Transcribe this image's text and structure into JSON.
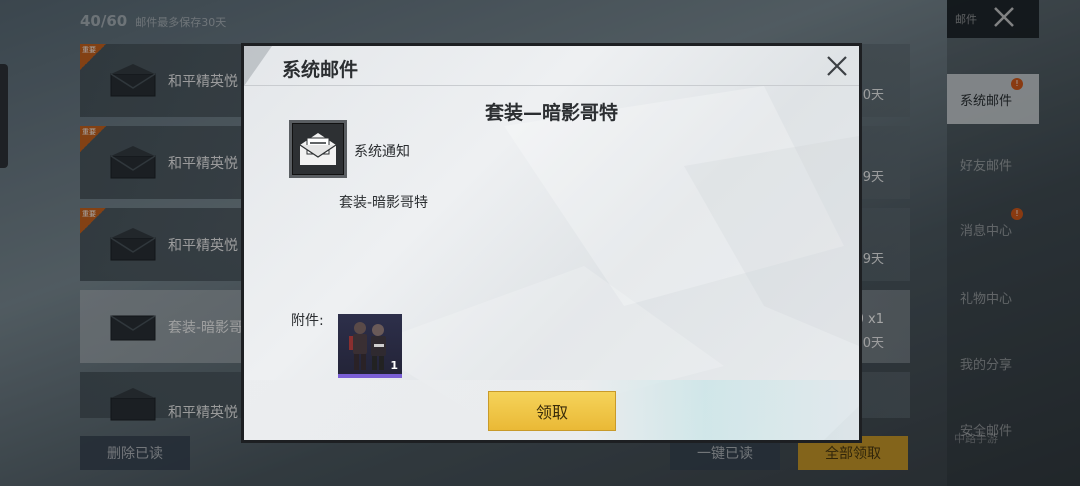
{
  "mailbox": {
    "count": "40/60",
    "note": "邮件最多保存30天",
    "new_badge": "重要",
    "items": [
      {
        "title": "和平精英悦",
        "days": "0天",
        "qty": ""
      },
      {
        "title": "和平精英悦",
        "days": "9天",
        "qty": ""
      },
      {
        "title": "和平精英悦",
        "days": "9天",
        "qty": ""
      },
      {
        "title": "套装-暗影哥",
        "days": "0天",
        "qty": "0 x1"
      },
      {
        "title": "和平精英悦",
        "days": "",
        "qty": ""
      }
    ],
    "delete_read_label": "删除已读",
    "read_all_label": "一键已读",
    "claim_all_label": "全部领取"
  },
  "sidebar": {
    "header_label": "邮件",
    "items": [
      {
        "label": "系统邮件",
        "active": true,
        "dot": "!"
      },
      {
        "label": "好友邮件",
        "active": false,
        "dot": ""
      },
      {
        "label": "消息中心",
        "active": false,
        "dot": "!"
      },
      {
        "label": "礼物中心",
        "active": false,
        "dot": ""
      },
      {
        "label": "我的分享",
        "active": false,
        "dot": ""
      },
      {
        "label": "安全邮件",
        "active": false,
        "dot": ""
      }
    ],
    "watermark": "中路手游"
  },
  "modal": {
    "header_title": "系统邮件",
    "subject": "套装—暗影哥特",
    "sender": "系统通知",
    "body": "套装-暗影哥特",
    "attachment_label": "附件:",
    "attachment": {
      "name": "套装-暗影哥特",
      "quantity": "1"
    },
    "claim_label": "领取"
  },
  "colors": {
    "accent_gold": "#eab936",
    "notice_dot": "#d35a1b",
    "rarity_purple": "#7a5fd6"
  }
}
